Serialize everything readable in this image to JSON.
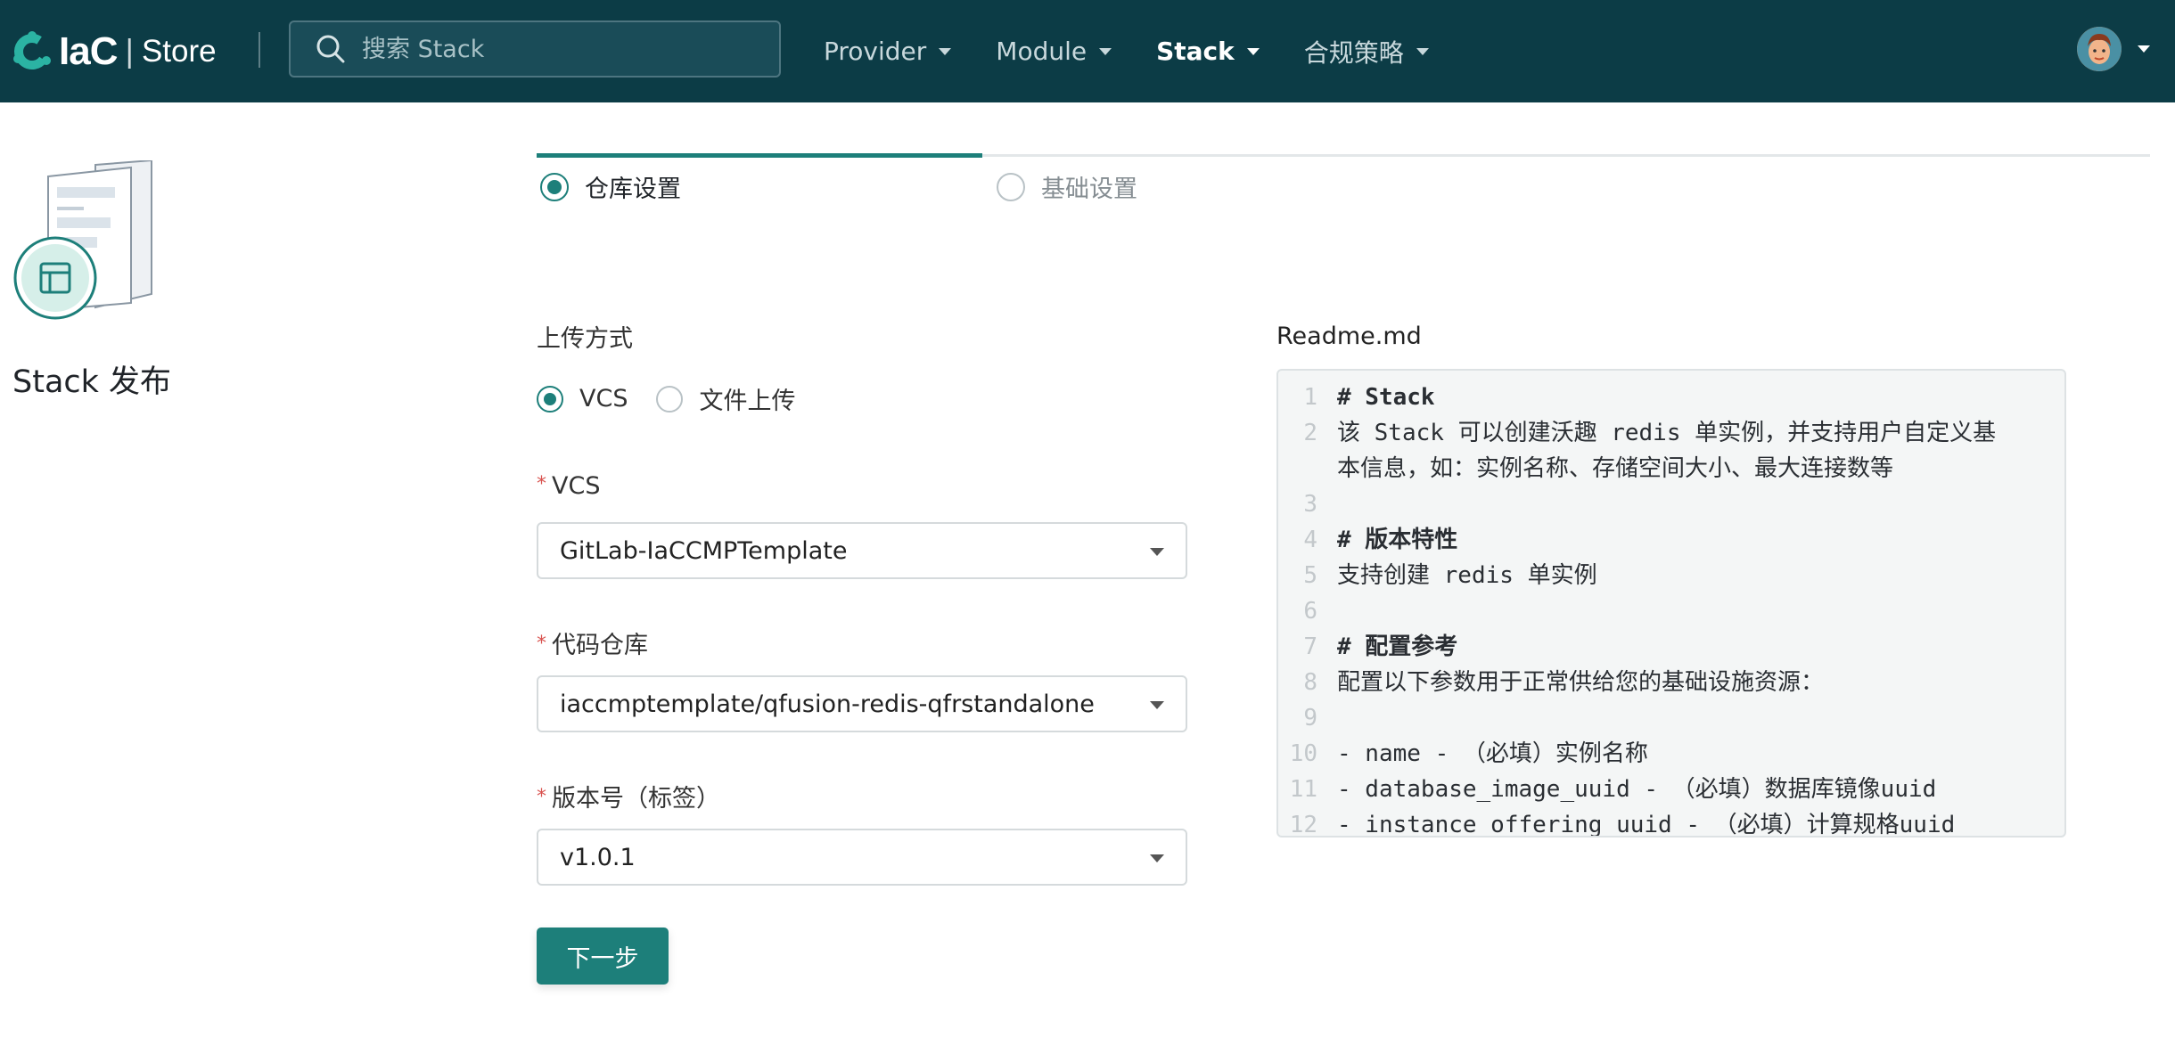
{
  "header": {
    "logo": {
      "iac": "IaC",
      "store": "Store"
    },
    "search_placeholder": "搜索 Stack",
    "nav": [
      {
        "label": "Provider",
        "active": false
      },
      {
        "label": "Module",
        "active": false
      },
      {
        "label": "Stack",
        "active": true
      },
      {
        "label": "合规策略",
        "active": false
      }
    ]
  },
  "left_panel": {
    "title": "Stack 发布"
  },
  "steps": [
    {
      "label": "仓库设置",
      "state": "active"
    },
    {
      "label": "基础设置",
      "state": "inactive"
    }
  ],
  "form": {
    "upload_method": {
      "label": "上传方式",
      "options": [
        {
          "label": "VCS",
          "checked": true
        },
        {
          "label": "文件上传",
          "checked": false
        }
      ]
    },
    "vcs": {
      "required_mark": "*",
      "label": "VCS",
      "value": "GitLab-IaCCMPTemplate"
    },
    "repo": {
      "required_mark": "*",
      "label": "代码仓库",
      "value": "iaccmptemplate/qfusion-redis-qfrstandalone"
    },
    "version": {
      "required_mark": "*",
      "label": "版本号（标签）",
      "value": "v1.0.1"
    },
    "next_button": "下一步"
  },
  "readme": {
    "title": "Readme.md",
    "lines": [
      {
        "num": "1",
        "text": "# Stack",
        "heading": true
      },
      {
        "num": "2",
        "text": "该 Stack 可以创建沃趣 redis 单实例，并支持用户自定义基",
        "heading": false
      },
      {
        "num": "",
        "text": "本信息，如：实例名称、存储空间大小、最大连接数等",
        "heading": false
      },
      {
        "num": "3",
        "text": "",
        "heading": false
      },
      {
        "num": "4",
        "text": "# 版本特性",
        "heading": true
      },
      {
        "num": "5",
        "text": "支持创建 redis 单实例",
        "heading": false
      },
      {
        "num": "6",
        "text": "",
        "heading": false
      },
      {
        "num": "7",
        "text": "# 配置参考",
        "heading": true
      },
      {
        "num": "8",
        "text": "配置以下参数用于正常供给您的基础设施资源：",
        "heading": false
      },
      {
        "num": "9",
        "text": "",
        "heading": false
      },
      {
        "num": "10",
        "text": "- name - （必填）实例名称",
        "heading": false
      },
      {
        "num": "11",
        "text": "- database_image_uuid - （必填）数据库镜像uuid",
        "heading": false
      },
      {
        "num": "12",
        "text": "- instance_offering_uuid - （必填）计算规格uuid",
        "heading": false
      }
    ]
  },
  "colors": {
    "header_bg": "#0c3c46",
    "accent": "#1d7f7a",
    "required": "#d9534f"
  }
}
